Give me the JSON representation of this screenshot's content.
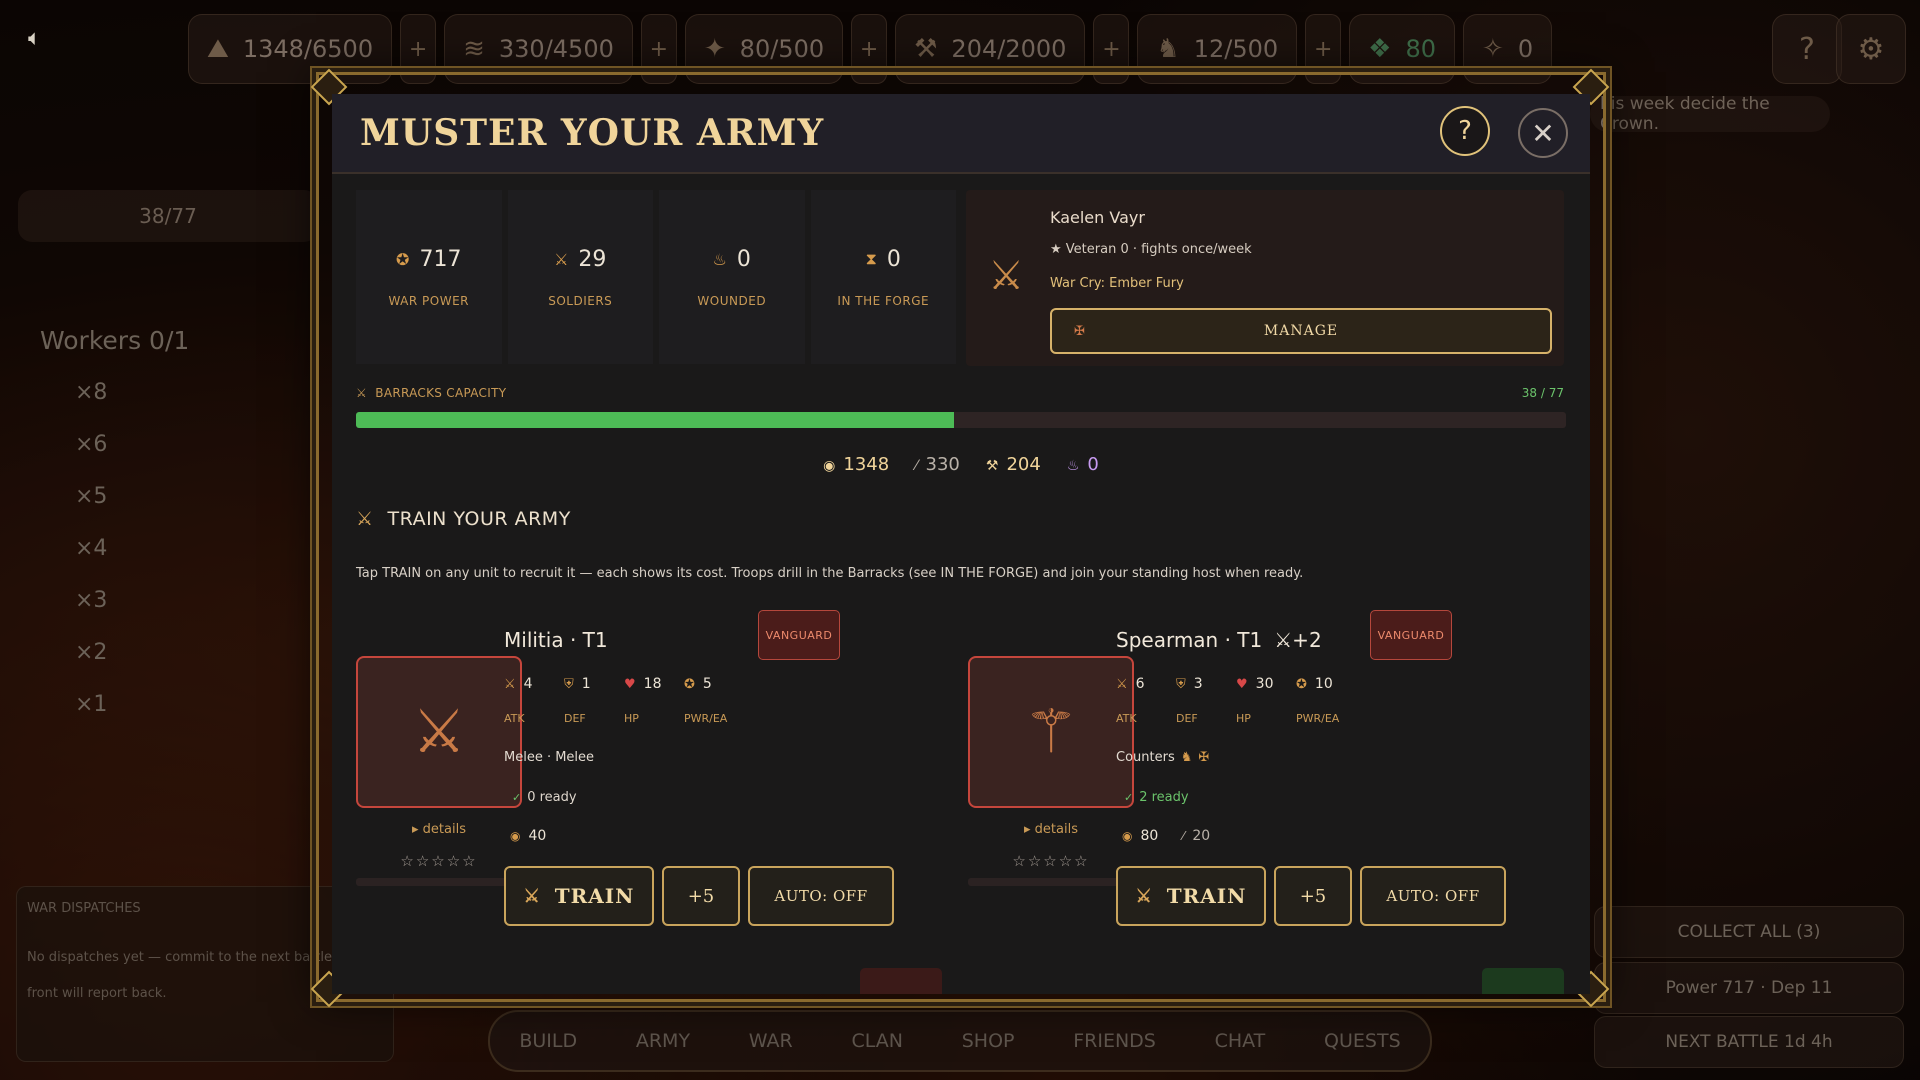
{
  "topbar": {
    "resources": [
      {
        "icon": "ore-icon",
        "value": "1348/6500",
        "glyph": "⛰"
      },
      {
        "icon": "wood-icon",
        "value": "330/4500",
        "glyph": "≋"
      },
      {
        "icon": "crop-icon",
        "value": "80/500",
        "glyph": "✦"
      },
      {
        "icon": "iron-icon",
        "value": "204/2000",
        "glyph": "⚒"
      },
      {
        "icon": "horse-icon",
        "value": "12/500",
        "glyph": "♞"
      }
    ],
    "gems": {
      "icon": "gem-icon",
      "value": "80"
    },
    "crest": {
      "icon": "crest-icon",
      "value": "0"
    },
    "plus_label": "+",
    "help_label": "?",
    "ticker": "his week decide the Crown."
  },
  "left": {
    "army_count": "38/77",
    "workers": "Workers 0/1",
    "worker_list": [
      "×8",
      "×6",
      "×5",
      "×4",
      "×3",
      "×2",
      "×1"
    ],
    "dispatch_title": "WAR DISPATCHES",
    "dispatch_text_1": "No dispatches yet — commit to the next battle a",
    "dispatch_text_2": "front will report back."
  },
  "right": {
    "collect": "COLLECT ALL  (3)",
    "power": "Power 717 · Dep 11",
    "next_battle": "NEXT BATTLE  1d 4h"
  },
  "nav": [
    "BUILD",
    "ARMY",
    "WAR",
    "CLAN",
    "SHOP",
    "FRIENDS",
    "CHAT",
    "QUESTS"
  ],
  "modal": {
    "title": "MUSTER YOUR ARMY",
    "help": "?",
    "close": "✕",
    "stats": [
      {
        "icon": "war-power-icon",
        "glyph": "✪",
        "value": "717",
        "label": "WAR POWER"
      },
      {
        "icon": "soldiers-icon",
        "glyph": "⚔",
        "value": "29",
        "label": "SOLDIERS"
      },
      {
        "icon": "wounded-icon",
        "glyph": "♨",
        "value": "0",
        "label": "WOUNDED"
      },
      {
        "icon": "hourglass-icon",
        "glyph": "⧗",
        "value": "0",
        "label": "IN THE FORGE"
      }
    ],
    "hero": {
      "name": "Kaelen Vayr",
      "veteran": "★ Veteran 0 · fights once/week",
      "war_cry": "War Cry: Ember Fury",
      "manage": "MANAGE"
    },
    "capacity": {
      "label": "BARRACKS CAPACITY",
      "count": "38 / 77",
      "fill": 0.494
    },
    "resources": [
      {
        "icon": "ore-icon",
        "glyph": "◉",
        "value": "1348",
        "color": "#f0d49a"
      },
      {
        "icon": "wood-icon",
        "glyph": "⁄",
        "value": "330",
        "color": "#b9b1a8"
      },
      {
        "icon": "iron-icon",
        "glyph": "⚒",
        "value": "204",
        "color": "#f0d49a"
      },
      {
        "icon": "essence-icon",
        "glyph": "♨",
        "value": "0",
        "color": "#c79af0"
      }
    ],
    "train_title": "TRAIN YOUR ARMY",
    "hint": "Tap TRAIN on any unit to recruit it — each shows its cost. Troops drill in the Barracks (see IN THE FORGE) and join your standing host when ready.",
    "units": [
      {
        "name": "Militia · T1",
        "bonus": "",
        "badge": "VANGUARD",
        "atk": "4",
        "def": "1",
        "hp": "18",
        "pwr": "5",
        "type": "Melee · Melee",
        "ready": "0 ready",
        "cost_ore": "40",
        "cost_wood": "",
        "details": "▸ details",
        "stars": "☆☆☆☆☆",
        "train": "TRAIN",
        "plus": "+5",
        "auto": "AUTO: OFF"
      },
      {
        "name": "Spearman · T1",
        "bonus": "⚔+2",
        "badge": "VANGUARD",
        "atk": "6",
        "def": "3",
        "hp": "30",
        "pwr": "10",
        "type": "Counters",
        "ready": "2 ready",
        "cost_ore": "80",
        "cost_wood": "20",
        "details": "▸ details",
        "stars": "☆☆☆☆☆",
        "train": "TRAIN",
        "plus": "+5",
        "auto": "AUTO: OFF"
      }
    ],
    "stat_labels": {
      "atk": "ATK",
      "def": "DEF",
      "hp": "HP",
      "pwr": "PWR/EA"
    }
  }
}
